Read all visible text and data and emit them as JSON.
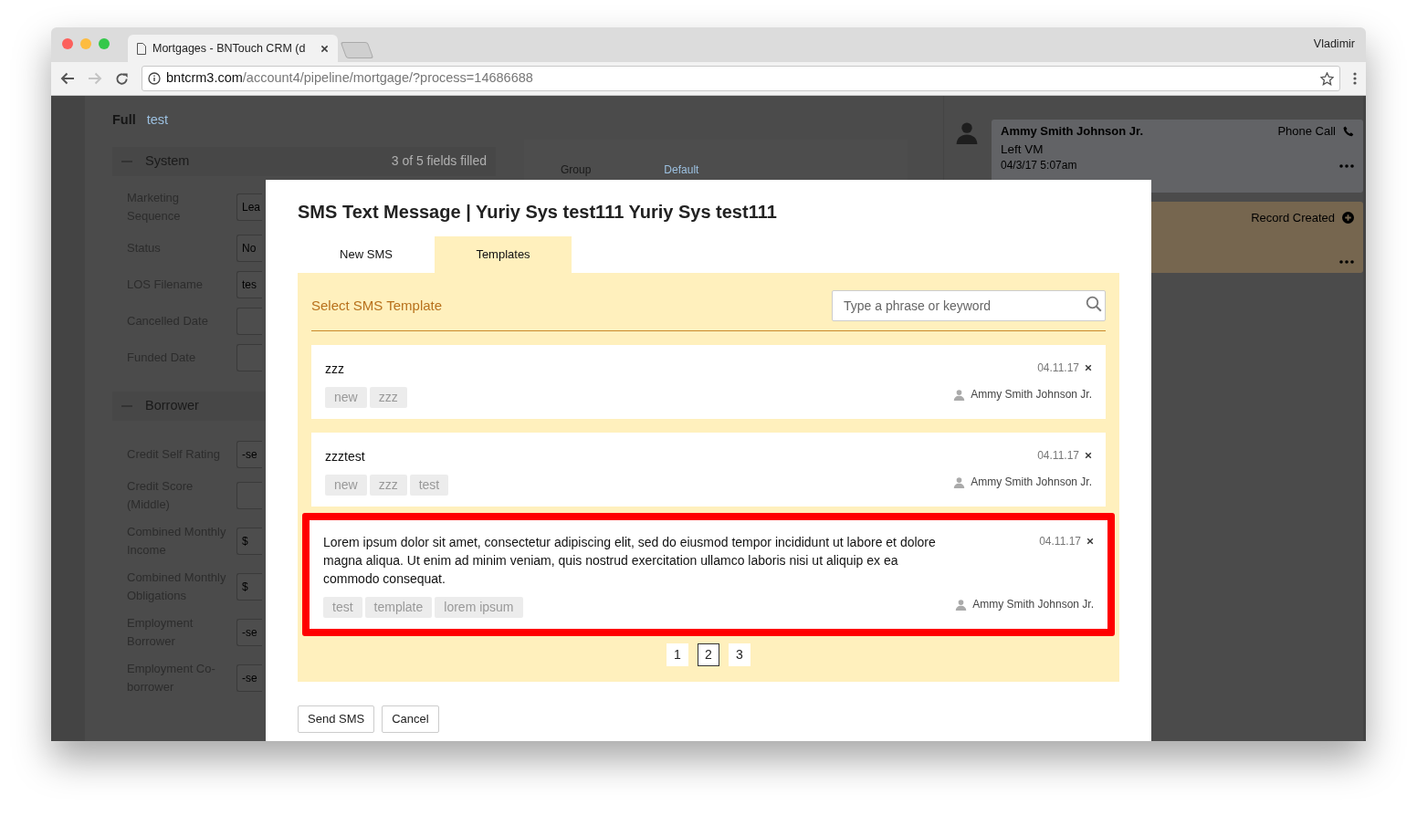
{
  "browser": {
    "tab_title": "Mortgages - BNTouch CRM (d",
    "user": "Vladimir",
    "url_host": "bntcrm3.com",
    "url_path": "/account4/pipeline/mortgage/?process=14686688"
  },
  "background": {
    "view_tabs": [
      {
        "label": "Full",
        "selected": true
      },
      {
        "label": "test",
        "selected": false
      }
    ],
    "sections": [
      {
        "title": "System",
        "summary": "3 of 5 fields filled",
        "fields": [
          {
            "label": "Marketing Sequence",
            "value": "Lea"
          },
          {
            "label": "Status",
            "value": "No"
          },
          {
            "label": "LOS Filename",
            "value": "tes"
          },
          {
            "label": "Cancelled Date"
          },
          {
            "label": "Funded Date"
          }
        ]
      },
      {
        "title": "Borrower",
        "fields": [
          {
            "label": "Credit Self Rating",
            "value": "-se"
          },
          {
            "label": "Credit Score (Middle)"
          },
          {
            "label": "Combined Monthly Income",
            "value": "$"
          },
          {
            "label": "Combined Monthly Obligations",
            "value": "$"
          },
          {
            "label": "Employment Borrower",
            "value": "-se"
          },
          {
            "label": "Employment Co-borrower",
            "value": "-se"
          }
        ]
      }
    ],
    "group_panel": {
      "label": "Group",
      "value": "Default"
    },
    "activity": [
      {
        "kind": "call",
        "author": "Ammy Smith Johnson Jr.",
        "type": "Phone Call",
        "text": "Left VM",
        "time": "04/3/17 5:07am"
      },
      {
        "kind": "record",
        "type": "Record Created"
      }
    ]
  },
  "modal": {
    "title": "SMS Text Message | Yuriy Sys test111 Yuriy Sys test111",
    "tabs": [
      {
        "label": "New SMS",
        "selected": false
      },
      {
        "label": "Templates",
        "selected": true
      }
    ],
    "panel_title": "Select SMS Template",
    "search": {
      "placeholder": "Type a phrase or keyword"
    },
    "templates": [
      {
        "text": "zzz",
        "date": "04.11.17",
        "tags": [
          "new",
          "zzz"
        ],
        "author": "Ammy Smith Johnson Jr.",
        "selected": false
      },
      {
        "text": "zzztest",
        "date": "04.11.17",
        "tags": [
          "new",
          "zzz",
          "test"
        ],
        "author": "Ammy Smith Johnson Jr.",
        "selected": false
      },
      {
        "text": "Lorem ipsum dolor sit amet, consectetur adipiscing elit, sed do eiusmod tempor incididunt ut labore et dolore magna aliqua. Ut enim ad minim veniam, quis nostrud exercitation ullamco laboris nisi ut aliquip ex ea commodo consequat.",
        "date": "04.11.17",
        "tags": [
          "test",
          "template",
          "lorem ipsum"
        ],
        "author": "Ammy Smith Johnson Jr.",
        "selected": true
      }
    ],
    "pages": [
      {
        "label": "1",
        "selected": false
      },
      {
        "label": "2",
        "selected": true
      },
      {
        "label": "3",
        "selected": false
      }
    ],
    "buttons": [
      "Send SMS",
      "Cancel"
    ]
  }
}
